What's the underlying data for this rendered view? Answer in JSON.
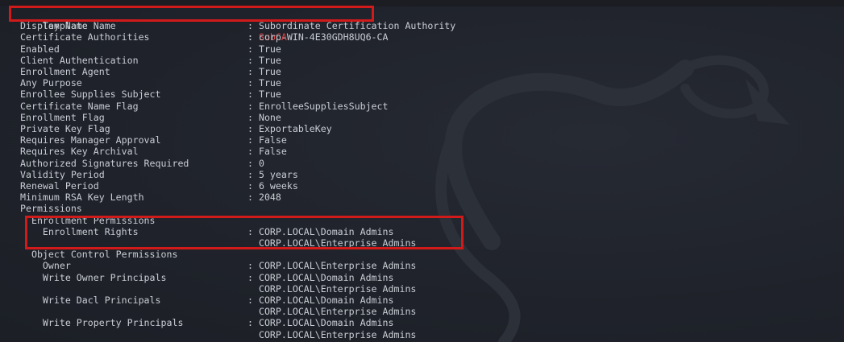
{
  "terminal": {
    "template_name": {
      "key": "Template Name",
      "value": "SubCA"
    },
    "rows": [
      {
        "key": "Display Name",
        "value": ": Subordinate Certification Authority"
      },
      {
        "key": "Certificate Authorities",
        "value": ": corp-WIN-4E30GDH8UQ6-CA"
      },
      {
        "key": "Enabled",
        "value": ": True"
      },
      {
        "key": "Client Authentication",
        "value": ": True"
      },
      {
        "key": "Enrollment Agent",
        "value": ": True"
      },
      {
        "key": "Any Purpose",
        "value": ": True"
      },
      {
        "key": "Enrollee Supplies Subject",
        "value": ": True"
      },
      {
        "key": "Certificate Name Flag",
        "value": ": EnrolleeSuppliesSubject"
      },
      {
        "key": "Enrollment Flag",
        "value": ": None"
      },
      {
        "key": "Private Key Flag",
        "value": ": ExportableKey"
      },
      {
        "key": "Requires Manager Approval",
        "value": ": False"
      },
      {
        "key": "Requires Key Archival",
        "value": ": False"
      },
      {
        "key": "Authorized Signatures Required",
        "value": ": 0"
      },
      {
        "key": "Validity Period",
        "value": ": 5 years"
      },
      {
        "key": "Renewal Period",
        "value": ": 6 weeks"
      },
      {
        "key": "Minimum RSA Key Length",
        "value": ": 2048"
      }
    ],
    "permissions_header": "Permissions",
    "enrollment_permissions_header": "  Enrollment Permissions",
    "enrollment_rights": {
      "key": "    Enrollment Rights",
      "value": ": CORP.LOCAL\\Domain Admins",
      "value2": "  CORP.LOCAL\\Enterprise Admins"
    },
    "object_control_header": "  Object Control Permissions",
    "owner": {
      "key": "    Owner",
      "value": ": CORP.LOCAL\\Enterprise Admins"
    },
    "write_owner": {
      "key": "    Write Owner Principals",
      "value": ": CORP.LOCAL\\Domain Admins",
      "value2": "  CORP.LOCAL\\Enterprise Admins"
    },
    "write_dacl": {
      "key": "    Write Dacl Principals",
      "value": ": CORP.LOCAL\\Domain Admins",
      "value2": "  CORP.LOCAL\\Enterprise Admins"
    },
    "write_property": {
      "key": "    Write Property Principals",
      "value": ": CORP.LOCAL\\Domain Admins",
      "value2": "  CORP.LOCAL\\Enterprise Admins"
    }
  },
  "colors": {
    "background": "#20232b",
    "text": "#c9cdd4",
    "highlight_box": "#d11a1a",
    "highlight_text": "#e04343"
  }
}
